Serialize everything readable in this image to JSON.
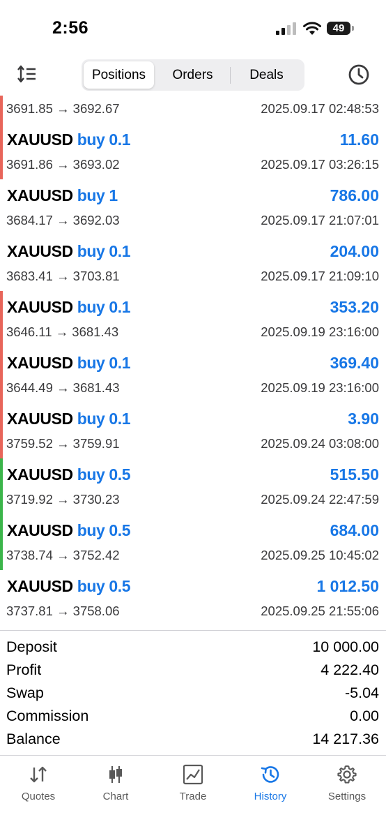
{
  "status_bar": {
    "time": "2:56",
    "battery": "49"
  },
  "top_nav": {
    "tabs": [
      "Positions",
      "Orders",
      "Deals"
    ],
    "active_tab": "Positions"
  },
  "partial_row": {
    "prices": "3691.85 → 3692.67",
    "time": "2025.09.17 02:48:53"
  },
  "positions": [
    {
      "symbol": "XAUUSD",
      "side": "buy 0.1",
      "profit": "11.60",
      "prices": "3691.86 → 3693.02",
      "time": "2025.09.17 03:26:15",
      "bar_color": "#e8655a"
    },
    {
      "symbol": "XAUUSD",
      "side": "buy 1",
      "profit": "786.00",
      "prices": "3684.17 → 3692.03",
      "time": "2025.09.17 21:07:01",
      "bar_color": ""
    },
    {
      "symbol": "XAUUSD",
      "side": "buy 0.1",
      "profit": "204.00",
      "prices": "3683.41 → 3703.81",
      "time": "2025.09.17 21:09:10",
      "bar_color": ""
    },
    {
      "symbol": "XAUUSD",
      "side": "buy 0.1",
      "profit": "353.20",
      "prices": "3646.11 → 3681.43",
      "time": "2025.09.19 23:16:00",
      "bar_color": "#e8655a"
    },
    {
      "symbol": "XAUUSD",
      "side": "buy 0.1",
      "profit": "369.40",
      "prices": "3644.49 → 3681.43",
      "time": "2025.09.19 23:16:00",
      "bar_color": "#e8655a"
    },
    {
      "symbol": "XAUUSD",
      "side": "buy 0.1",
      "profit": "3.90",
      "prices": "3759.52 → 3759.91",
      "time": "2025.09.24 03:08:00",
      "bar_color": "#e8655a"
    },
    {
      "symbol": "XAUUSD",
      "side": "buy 0.5",
      "profit": "515.50",
      "prices": "3719.92 → 3730.23",
      "time": "2025.09.24 22:47:59",
      "bar_color": "#3bb54a"
    },
    {
      "symbol": "XAUUSD",
      "side": "buy 0.5",
      "profit": "684.00",
      "prices": "3738.74 → 3752.42",
      "time": "2025.09.25 10:45:02",
      "bar_color": "#3bb54a"
    },
    {
      "symbol": "XAUUSD",
      "side": "buy 0.5",
      "profit": "1 012.50",
      "prices": "3737.81 → 3758.06",
      "time": "2025.09.25 21:55:06",
      "bar_color": ""
    }
  ],
  "summary": [
    {
      "label": "Deposit",
      "value": "10 000.00"
    },
    {
      "label": "Profit",
      "value": "4 222.40"
    },
    {
      "label": "Swap",
      "value": "-5.04"
    },
    {
      "label": "Commission",
      "value": "0.00"
    },
    {
      "label": "Balance",
      "value": "14 217.36"
    }
  ],
  "tab_bar": {
    "active": "History",
    "tabs": [
      {
        "label": "Quotes",
        "icon": "quotes-arrows-icon"
      },
      {
        "label": "Chart",
        "icon": "candlestick-icon"
      },
      {
        "label": "Trade",
        "icon": "trade-chart-icon"
      },
      {
        "label": "History",
        "icon": "history-clock-icon"
      },
      {
        "label": "Settings",
        "icon": "gear-icon"
      }
    ]
  },
  "colors": {
    "accent": "#1877e6",
    "loss_bar": "#e8655a",
    "gain_bar": "#3bb54a"
  }
}
